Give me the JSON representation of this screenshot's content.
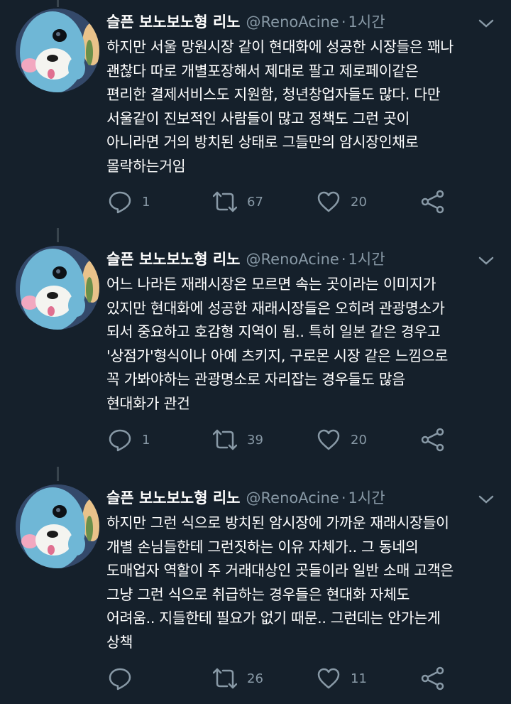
{
  "colors": {
    "background": "#15202b",
    "text": "#ffffff",
    "muted": "#8899a6",
    "thread_line": "#38444d"
  },
  "tweets": [
    {
      "name": "슬픈 보노보노형 리노",
      "handle": "@RenoAcine",
      "separator": "·",
      "time": "1시간",
      "lines": [
        "하지만 서울 망원시장 같이 현대화에 성공한 시장들은 꽤나",
        "괜찮다 따로 개별포장해서 제대로 팔고 제로페이같은",
        "편리한 결제서비스도 지원함, 청년창업자들도 많다. 다만",
        "서울같이 진보적인 사람들이 많고 정책도 그런 곳이",
        "아니라면 거의 방치된 상태로 그들만의 암시장인채로",
        "몰락하는거임"
      ],
      "replies": "1",
      "retweets": "67",
      "likes": "20"
    },
    {
      "name": "슬픈 보노보노형 리노",
      "handle": "@RenoAcine",
      "separator": "·",
      "time": "1시간",
      "lines": [
        "어느 나라든 재래시장은 모르면 속는 곳이라는 이미지가",
        "있지만 현대화에 성공한 재래시장들은 오히려 관광명소가",
        "되서 중요하고 호감형 지역이 됨.. 특히 일본 같은 경우고",
        "'상점가'형식이나 아예 츠키지, 구로몬 시장 같은 느낌으로",
        "꼭 가봐야하는 관광명소로 자리잡는 경우들도 많음",
        "현대화가 관건"
      ],
      "replies": "1",
      "retweets": "39",
      "likes": "20"
    },
    {
      "name": "슬픈 보노보노형 리노",
      "handle": "@RenoAcine",
      "separator": "·",
      "time": "1시간",
      "lines": [
        "하지만 그런 식으로 방치된 암시장에 가까운 재래시장들이",
        "개별 손님들한테 그런짓하는 이유 자체가.. 그 동네의",
        "도매업자 역할이 주 거래대상인 곳들이라 일반 소매 고객은",
        "그냥 그런 식으로 취급하는 경우들은 현대화 자체도",
        "어려움.. 지들한테 필요가 없기 때문.. 그런데는 안가는게",
        "상책"
      ],
      "replies": "",
      "retweets": "26",
      "likes": "11"
    }
  ]
}
